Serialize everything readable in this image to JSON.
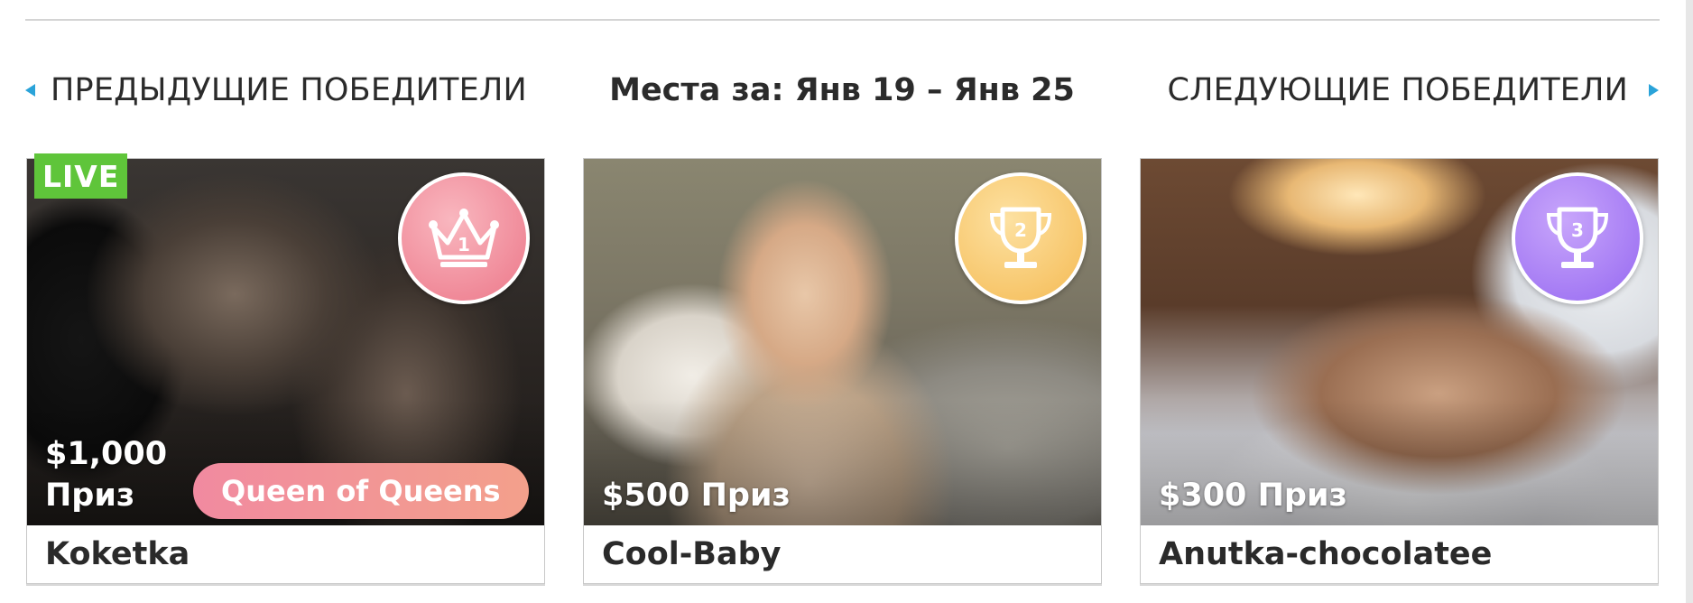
{
  "nav": {
    "prev_label": "ПРЕДЫДУЩИЕ ПОБЕДИТЕЛИ",
    "next_label": "СЛЕДУЮЩИЕ ПОБЕДИТЕЛИ",
    "period_title": "Места за: Янв 19 – Янв 25"
  },
  "accent_color": "#2aa3d9",
  "winners": [
    {
      "place": "1",
      "medal_icon": "crown-icon",
      "medal_color": "#f08a99",
      "name": "Koketka",
      "prize": "$1,000 Приз",
      "prize_line1": "$1,000",
      "prize_line2": "Приз",
      "live_badge": "LIVE",
      "award": "Queen of Queens"
    },
    {
      "place": "2",
      "medal_icon": "trophy-icon",
      "medal_color": "#f7c66b",
      "name": "Cool-Baby",
      "prize": "$500 Приз"
    },
    {
      "place": "3",
      "medal_icon": "trophy-icon",
      "medal_color": "#a57bf4",
      "name": "Anutka-chocolatee",
      "prize": "$300 Приз"
    }
  ]
}
